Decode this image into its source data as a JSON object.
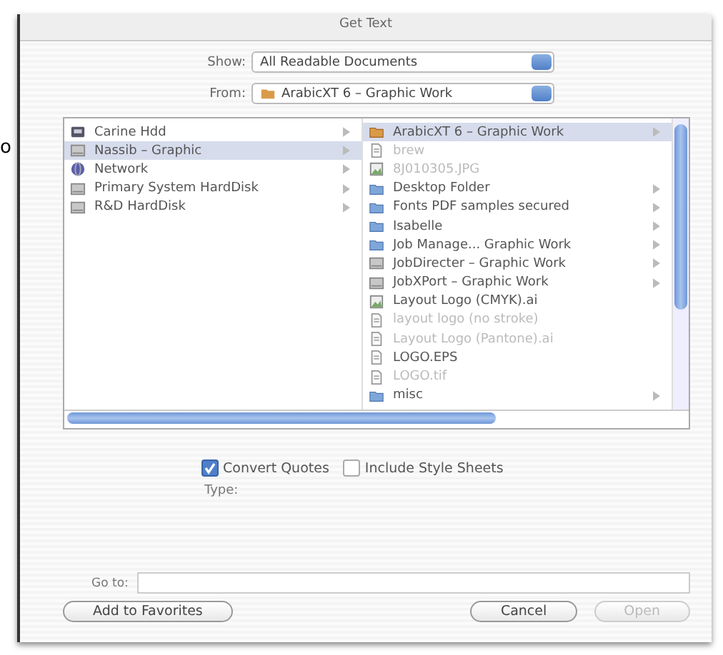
{
  "background_text": "o",
  "window": {
    "title": "Get Text"
  },
  "show": {
    "label": "Show:",
    "value": "All Readable Documents"
  },
  "from": {
    "label": "From:",
    "value": "ArabicXT 6 – Graphic Work"
  },
  "browser": {
    "columns": [
      {
        "items": [
          {
            "name": "Carine Hdd",
            "kind": "disk",
            "selected": false,
            "disabled": false,
            "has_children": true
          },
          {
            "name": "Nassib – Graphic",
            "kind": "drive",
            "selected": true,
            "disabled": false,
            "has_children": true
          },
          {
            "name": "Network",
            "kind": "network",
            "selected": false,
            "disabled": false,
            "has_children": true
          },
          {
            "name": "Primary System HardDisk",
            "kind": "drive",
            "selected": false,
            "disabled": false,
            "has_children": true
          },
          {
            "name": "R&D HardDisk",
            "kind": "drive",
            "selected": false,
            "disabled": false,
            "has_children": true
          }
        ]
      },
      {
        "items": [
          {
            "name": "ArabicXT 6 – Graphic Work",
            "kind": "app",
            "selected": true,
            "disabled": false,
            "has_children": true
          },
          {
            "name": "brew",
            "kind": "doc",
            "selected": false,
            "disabled": true,
            "has_children": false
          },
          {
            "name": "8J010305.JPG",
            "kind": "image",
            "selected": false,
            "disabled": true,
            "has_children": false
          },
          {
            "name": "Desktop Folder",
            "kind": "folder",
            "selected": false,
            "disabled": false,
            "has_children": true
          },
          {
            "name": "Fonts PDF samples secured",
            "kind": "folder",
            "selected": false,
            "disabled": false,
            "has_children": true
          },
          {
            "name": "Isabelle",
            "kind": "folder",
            "selected": false,
            "disabled": false,
            "has_children": true
          },
          {
            "name": "Job Manage... Graphic Work",
            "kind": "folder",
            "selected": false,
            "disabled": false,
            "has_children": true
          },
          {
            "name": "JobDirecter – Graphic Work",
            "kind": "drive",
            "selected": false,
            "disabled": false,
            "has_children": true
          },
          {
            "name": "JobXPort – Graphic Work",
            "kind": "drive",
            "selected": false,
            "disabled": false,
            "has_children": true
          },
          {
            "name": "Layout Logo (CMYK).ai",
            "kind": "image",
            "selected": false,
            "disabled": false,
            "has_children": false
          },
          {
            "name": "layout logo (no stroke)",
            "kind": "doc",
            "selected": false,
            "disabled": true,
            "has_children": false
          },
          {
            "name": "Layout Logo (Pantone).ai",
            "kind": "doc",
            "selected": false,
            "disabled": true,
            "has_children": false
          },
          {
            "name": "LOGO.EPS",
            "kind": "doc",
            "selected": false,
            "disabled": false,
            "has_children": false
          },
          {
            "name": "LOGO.tif",
            "kind": "doc",
            "selected": false,
            "disabled": true,
            "has_children": false
          },
          {
            "name": "misc",
            "kind": "folder",
            "selected": false,
            "disabled": false,
            "has_children": true
          }
        ]
      }
    ]
  },
  "options": [
    {
      "label": "Convert Quotes",
      "checked": true
    },
    {
      "label": "Include Style Sheets",
      "checked": false
    }
  ],
  "type_label": "Type:",
  "go_to": {
    "label": "Go to:"
  },
  "buttons": [
    {
      "label": "Add to Favorites",
      "disabled": false
    },
    {
      "label": "Cancel",
      "disabled": false
    },
    {
      "label": "Open",
      "disabled": true
    }
  ]
}
